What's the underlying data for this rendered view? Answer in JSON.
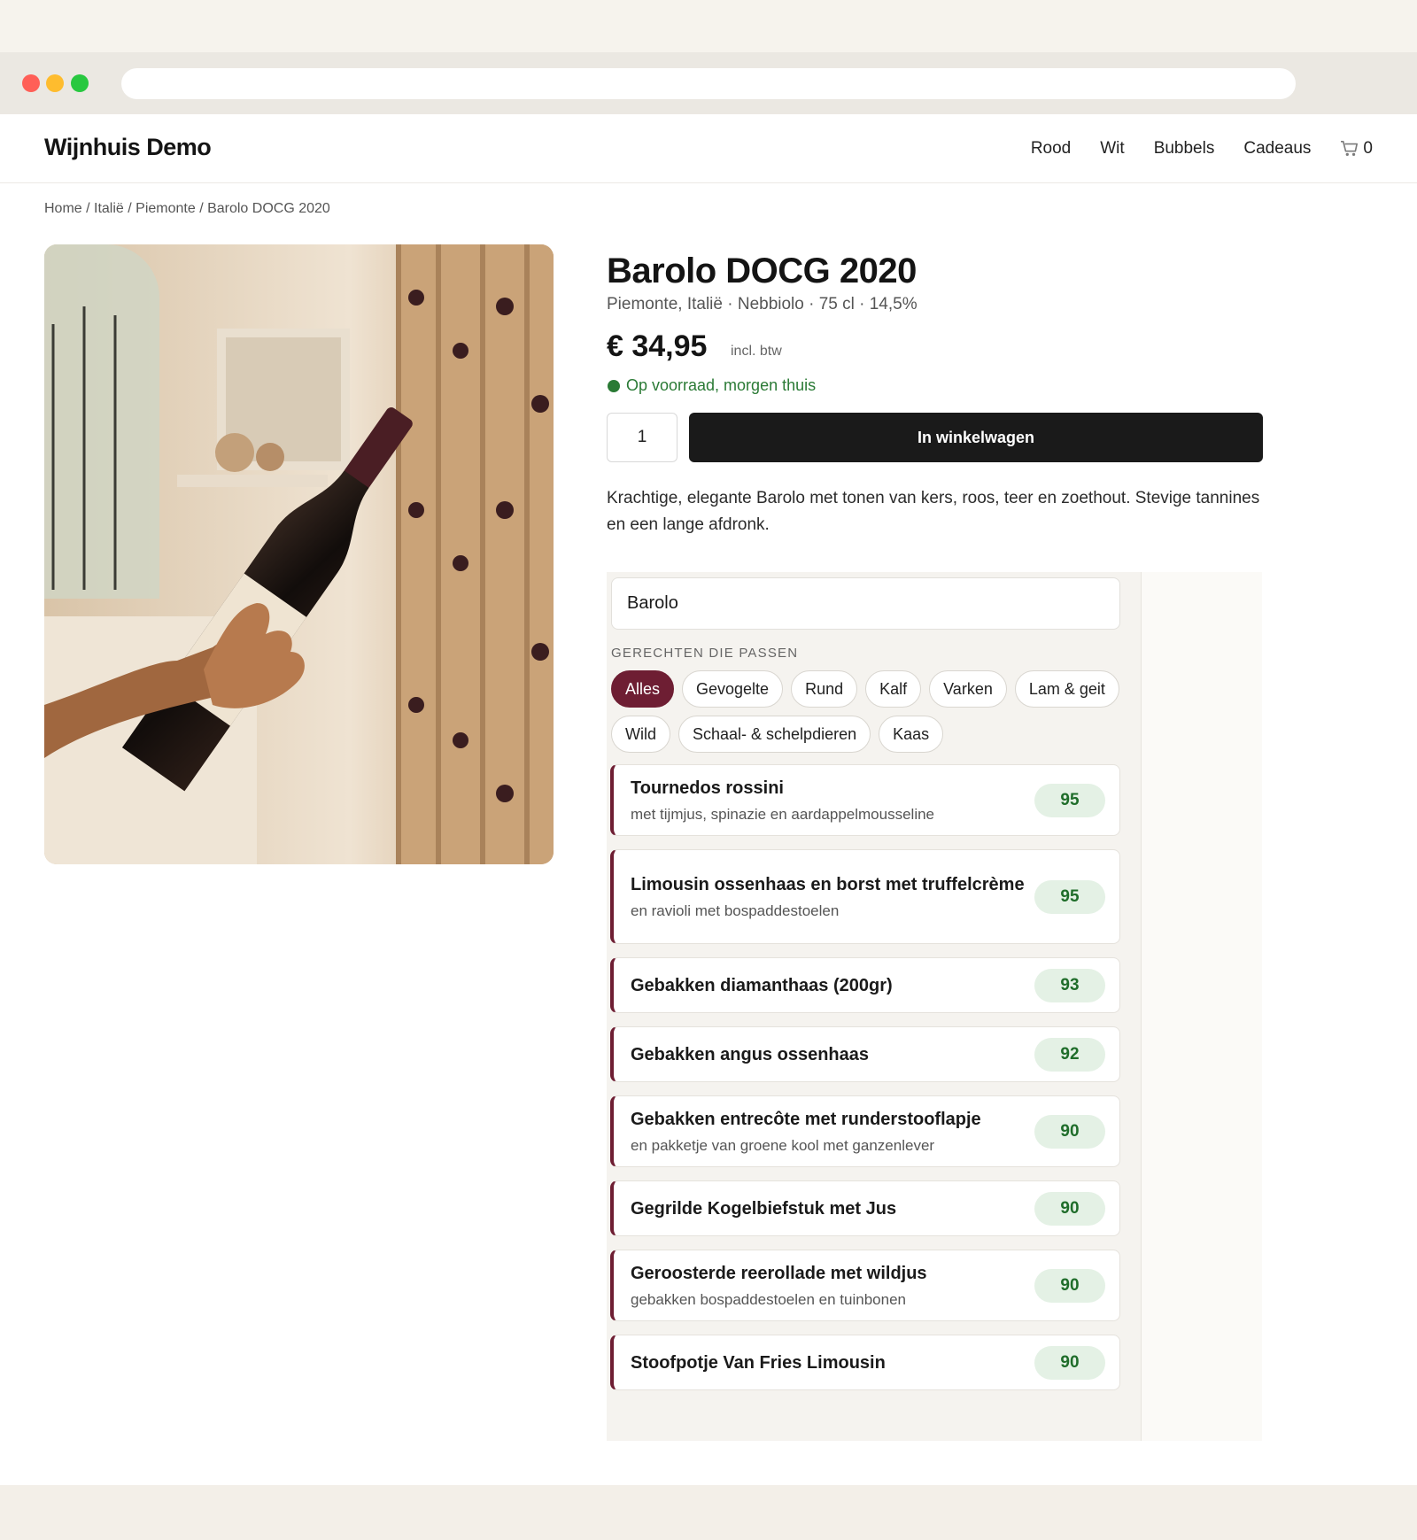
{
  "site": {
    "brand": "Wijnhuis Demo",
    "nav": [
      "Rood",
      "Wit",
      "Bubbels",
      "Cadeaus"
    ],
    "cart_count": "0"
  },
  "breadcrumb": "Home / Italië / Piemonte / Barolo DOCG 2020",
  "product": {
    "title": "Barolo DOCG 2020",
    "subtitle": "Piemonte, Italië · Nebbiolo · 75 cl · 14,5%",
    "price": "€ 34,95",
    "vat": "incl. btw",
    "stock": "Op voorraad, morgen thuis",
    "quantity": "1",
    "cta": "In winkelwagen",
    "description": "Krachtige, elegante Barolo met tonen van kers, roos, teer en zoethout. Stevige tannines en een lange afdronk."
  },
  "pairing": {
    "search_value": "Barolo",
    "section_label": "GERECHTEN DIE PASSEN",
    "filters": [
      "Alles",
      "Gevogelte",
      "Rund",
      "Kalf",
      "Varken",
      "Lam & geit",
      "Wild",
      "Schaal- & schelpdieren",
      "Kaas"
    ],
    "active_filter": "Alles",
    "dishes": [
      {
        "name": "Tournedos rossini",
        "sub": "met tijmjus, spinazie en aardappelmousseline",
        "score": "95"
      },
      {
        "name": "Limousin ossenhaas en borst met truffelcrème",
        "sub": "en ravioli met bospaddestoelen",
        "score": "95"
      },
      {
        "name": "Gebakken diamanthaas (200gr)",
        "sub": "",
        "score": "93"
      },
      {
        "name": "Gebakken angus ossenhaas",
        "sub": "",
        "score": "92"
      },
      {
        "name": "Gebakken entrecôte met runderstooflapje",
        "sub": "en pakketje van groene kool met ganzenlever",
        "score": "90"
      },
      {
        "name": "Gegrilde Kogelbiefstuk met Jus",
        "sub": "",
        "score": "90"
      },
      {
        "name": "Geroosterde reerollade met wildjus",
        "sub": "gebakken bospaddestoelen en tuinbonen",
        "score": "90"
      },
      {
        "name": "Stoofpotje Van Fries Limousin",
        "sub": "",
        "score": "90"
      }
    ]
  },
  "colors": {
    "accent": "#6e1e33",
    "stock_green": "#2a7a35",
    "score_bg": "#e4f1e5",
    "cta_bg": "#1a1a1a"
  },
  "icons": [
    "cart-icon"
  ]
}
